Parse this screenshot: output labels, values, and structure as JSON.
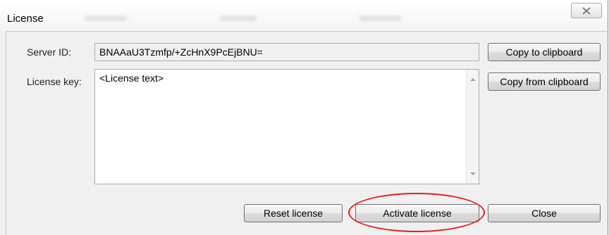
{
  "window": {
    "title": "License",
    "close_icon": "close-x-icon"
  },
  "form": {
    "server_id_label": "Server ID:",
    "server_id_value": "BNAAaU3Tzmfp/+ZcHnX9PcEjBNU=",
    "license_key_label": "License key:",
    "license_key_value": "<License text>"
  },
  "buttons": {
    "copy_to_clipboard": "Copy to clipboard",
    "copy_from_clipboard": "Copy from clipboard",
    "reset_license": "Reset license",
    "activate_license": "Activate license",
    "close": "Close"
  },
  "annotation": {
    "highlight_color": "#e02020"
  }
}
